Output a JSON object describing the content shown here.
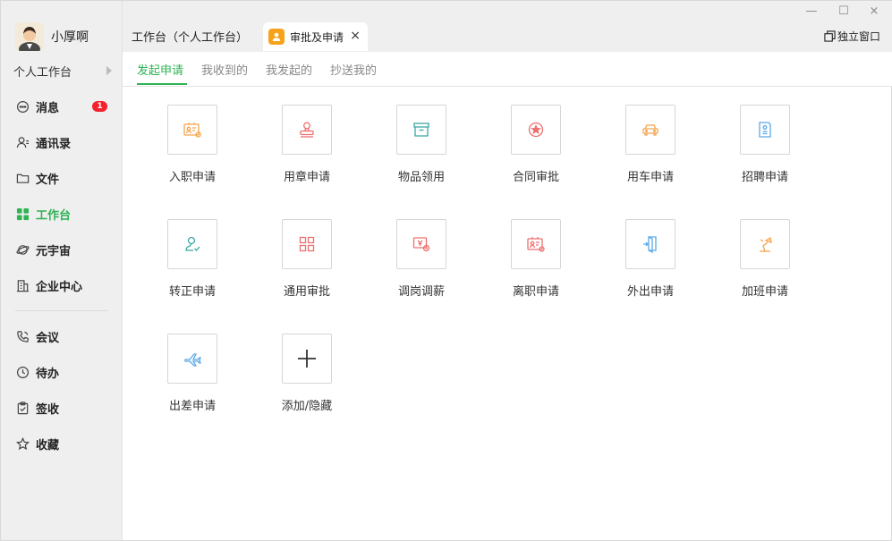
{
  "user": {
    "name": "小厚啊"
  },
  "workspace": {
    "label": "个人工作台"
  },
  "sidebar": {
    "items": [
      {
        "label": "消息",
        "badge": "1"
      },
      {
        "label": "通讯录"
      },
      {
        "label": "文件"
      },
      {
        "label": "工作台",
        "active": true
      },
      {
        "label": "元宇宙"
      },
      {
        "label": "企业中心"
      },
      {
        "label": "会议"
      },
      {
        "label": "待办"
      },
      {
        "label": "签收"
      },
      {
        "label": "收藏"
      }
    ]
  },
  "tabs": {
    "tab1": "工作台（个人工作台）",
    "tab2": "审批及申请",
    "close": "×"
  },
  "window": {
    "minimize": "—",
    "maximize": "☐",
    "close": "×",
    "standalone": "独立窗口"
  },
  "subtabs": [
    "发起申请",
    "我收到的",
    "我发起的",
    "抄送我的"
  ],
  "apps": [
    {
      "label": "入职申请"
    },
    {
      "label": "用章申请"
    },
    {
      "label": "物品领用"
    },
    {
      "label": "合同审批"
    },
    {
      "label": "用车申请"
    },
    {
      "label": "招聘申请"
    },
    {
      "label": "转正申请"
    },
    {
      "label": "通用审批"
    },
    {
      "label": "调岗调薪"
    },
    {
      "label": "离职申请"
    },
    {
      "label": "外出申请"
    },
    {
      "label": "加班申请"
    },
    {
      "label": "出差申请"
    },
    {
      "label": "添加/隐藏"
    }
  ],
  "colors": {
    "accent": "#2fb355",
    "orange": "#f7a34b",
    "red": "#ef6f6f",
    "teal": "#3aa8a5",
    "blue": "#5aa9e6",
    "badge": "#f5222d"
  }
}
